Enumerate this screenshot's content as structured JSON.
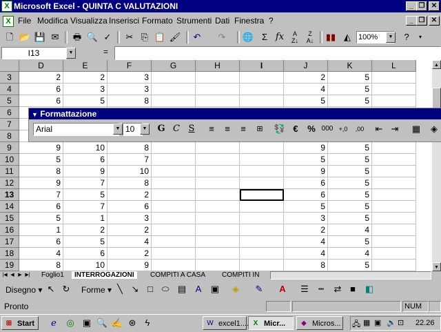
{
  "window": {
    "title": "Microsoft Excel - QUINTA C VALUTAZIONI"
  },
  "menu": [
    "File",
    "Modifica",
    "Visualizza",
    "Inserisci",
    "Formato",
    "Strumenti",
    "Dati",
    "Finestra",
    "?"
  ],
  "toolbar": {
    "zoom": "100%"
  },
  "formula_bar": {
    "name_box": "I13",
    "equals": "=",
    "value": ""
  },
  "columns": [
    "D",
    "E",
    "F",
    "G",
    "H",
    "I",
    "J",
    "K",
    "L"
  ],
  "rows": [
    {
      "n": "3",
      "D": "2",
      "E": "2",
      "F": "3",
      "J": "2",
      "K": "5"
    },
    {
      "n": "4",
      "D": "6",
      "E": "3",
      "F": "3",
      "J": "4",
      "K": "5"
    },
    {
      "n": "5",
      "D": "6",
      "E": "5",
      "F": "8",
      "J": "5",
      "K": "5"
    },
    {
      "n": "6",
      "D": "",
      "E": "",
      "F": "",
      "J": "",
      "K": ""
    },
    {
      "n": "7",
      "D": "",
      "E": "",
      "F": "",
      "J": "",
      "K": ""
    },
    {
      "n": "8",
      "D": "",
      "E": "",
      "F": "",
      "J": "",
      "K": ""
    },
    {
      "n": "9",
      "D": "9",
      "E": "10",
      "F": "8",
      "J": "9",
      "K": "5"
    },
    {
      "n": "10",
      "D": "5",
      "E": "6",
      "F": "7",
      "J": "5",
      "K": "5"
    },
    {
      "n": "11",
      "D": "8",
      "E": "9",
      "F": "10",
      "J": "9",
      "K": "5"
    },
    {
      "n": "12",
      "D": "9",
      "E": "7",
      "F": "8",
      "J": "6",
      "K": "5"
    },
    {
      "n": "13",
      "D": "7",
      "E": "5",
      "F": "2",
      "J": "6",
      "K": "5"
    },
    {
      "n": "14",
      "D": "6",
      "E": "7",
      "F": "6",
      "J": "5",
      "K": "5"
    },
    {
      "n": "15",
      "D": "5",
      "E": "1",
      "F": "3",
      "J": "3",
      "K": "5"
    },
    {
      "n": "16",
      "D": "1",
      "E": "2",
      "F": "2",
      "J": "2",
      "K": "4"
    },
    {
      "n": "17",
      "D": "6",
      "E": "5",
      "F": "4",
      "J": "4",
      "K": "5"
    },
    {
      "n": "18",
      "D": "4",
      "E": "6",
      "F": "2",
      "J": "4",
      "K": "4"
    },
    {
      "n": "19",
      "D": "8",
      "E": "10",
      "F": "9",
      "J": "8",
      "K": "5"
    }
  ],
  "formatting_toolbar": {
    "title": "Formattazione",
    "font": "Arial",
    "size": "10"
  },
  "sheet_tabs": [
    "Foglio1",
    "INTERROGAZIONI",
    "COMPITI A CASA",
    "COMPITI IN"
  ],
  "drawing": {
    "draw_label": "Disegno",
    "shapes_label": "Forme"
  },
  "status": {
    "text": "Pronto",
    "num": "NUM"
  },
  "taskbar": {
    "start": "Start",
    "tasks": [
      "excel1....",
      "Micr...",
      "Micros..."
    ],
    "clock": "22.26"
  }
}
